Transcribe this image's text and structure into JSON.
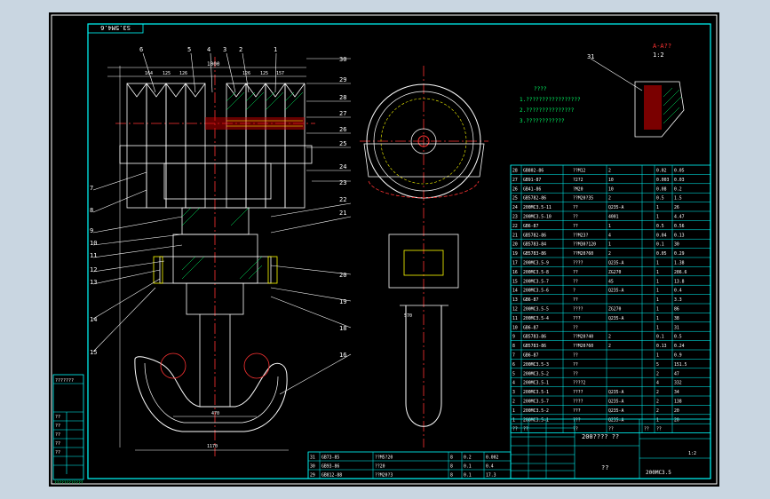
{
  "title_tag": "S3.5M4.6",
  "section_view": {
    "title": "A-A??",
    "scale": "1:2"
  },
  "tech_notes": [
    "????",
    "1.?????????????????",
    "2.???????????????",
    "3.????????????"
  ],
  "top_view_callouts": [
    "6",
    "5",
    "4",
    "3",
    "2",
    "1",
    "30",
    "29",
    "28",
    "27",
    "26",
    "25",
    "24",
    "23"
  ],
  "top_dims": {
    "left": [
      "164",
      "125",
      "126"
    ],
    "right": [
      "126",
      "125",
      "157"
    ],
    "overall": "1000"
  },
  "left_view_callouts": [
    "7",
    "8",
    "9",
    "10",
    "11",
    "12",
    "13",
    "14",
    "15"
  ],
  "mid_callouts": [
    "22",
    "21",
    "20",
    "19",
    "18",
    "16"
  ],
  "detail_callout": "31",
  "dims_bottom": {
    "spread": "470",
    "hook": "570",
    "width": "1170",
    "side": "570"
  },
  "bom_rows": [
    [
      "28",
      "GB802-86",
      "??M12",
      "2",
      "0.02",
      "0.05"
    ],
    [
      "27",
      "GB91-87",
      "?2?2",
      "10",
      "0.003",
      "0.03"
    ],
    [
      "26",
      "GB41-86",
      "?M20",
      "10",
      "0.08",
      "0.2"
    ],
    [
      "25",
      "GB5782-86",
      "??M20?35",
      "2",
      "0.5",
      "1.5"
    ],
    [
      "24",
      "200MC3.5-11",
      "??",
      "Q235-A",
      "1",
      "26"
    ],
    [
      "23",
      "200MC3.5-10",
      "??",
      "4001",
      "1",
      "4.47"
    ],
    [
      "22",
      "GB6-87",
      "??",
      "1",
      "0.5",
      "0.56"
    ],
    [
      "21",
      "GB5782-86",
      "??M23?",
      "4",
      "0.04",
      "0.13"
    ],
    [
      "20",
      "GB5783-84",
      "??M30?120",
      "1",
      "0.1",
      "30"
    ],
    [
      "19",
      "GB5783-86",
      "??M20?60",
      "2",
      "0.05",
      "0.29"
    ],
    [
      "17",
      "200MC3.5-9",
      "????",
      "Q235-A",
      "1",
      "1.38"
    ],
    [
      "16",
      "200MC3.5-8",
      "??",
      "ZG270",
      "1",
      "286.6"
    ],
    [
      "15",
      "200MC3.5-7",
      "??",
      "45",
      "1",
      "13.8"
    ],
    [
      "14",
      "200MC3.5-6",
      "?",
      "Q235-A",
      "1",
      "0.4"
    ],
    [
      "13",
      "GB6-87",
      "??",
      "",
      "1",
      "3.3"
    ],
    [
      "12",
      "200MC3.5-5",
      "????",
      "ZG270",
      "1",
      "86"
    ],
    [
      "11",
      "200MC3.5-4",
      "???",
      "Q235-A",
      "1",
      "38"
    ],
    [
      "10",
      "GB6-87",
      "??",
      "",
      "1",
      "31"
    ],
    [
      "9",
      "GB5783-86",
      "??M20?40",
      "2",
      "0.1",
      "0.5"
    ],
    [
      "8",
      "GB5783-86",
      "??M20?60",
      "2",
      "0.13",
      "0.24"
    ],
    [
      "7",
      "GB6-87",
      "??",
      "",
      "1",
      "0.9"
    ],
    [
      "6",
      "200MC3.5-3",
      "??",
      "",
      "5",
      "151.5"
    ],
    [
      "5",
      "200MC3.5-2",
      "??",
      "",
      "2",
      "47"
    ],
    [
      "4",
      "200MC3.5-1",
      "????2",
      "",
      "4",
      "332"
    ],
    [
      "3",
      "200MC3.5-1",
      "????",
      "Q235-A",
      "2",
      "34"
    ],
    [
      "2",
      "200MC3.5-7",
      "????",
      "Q235-A",
      "2",
      "138"
    ],
    [
      "1",
      "200MC3.5-2",
      "???",
      "Q235-A",
      "2",
      "20"
    ],
    [
      "1",
      "200MC3.5-1",
      "???",
      "Q235-A",
      "1",
      "20"
    ]
  ],
  "bom_header": [
    "??",
    "??",
    "??",
    "??",
    "??",
    "??"
  ],
  "title_block": {
    "name": "200???? ??",
    "drawing_no": "200MC3.5",
    "scale": "1:2",
    "mass": "??"
  },
  "small_table": [
    [
      "31",
      "GB73-85",
      "??M5?20",
      "8",
      "0.2",
      "0.002"
    ],
    [
      "30",
      "GB93-86",
      "??20",
      "8",
      "0.1",
      "0.4"
    ],
    [
      "29",
      "GB812-88",
      "??M20?3",
      "8",
      "0.1",
      "17.3"
    ]
  ],
  "left_strip": [
    "???????",
    "??",
    "??",
    "??",
    "??",
    "??"
  ],
  "left_strip_footer": "????????????"
}
